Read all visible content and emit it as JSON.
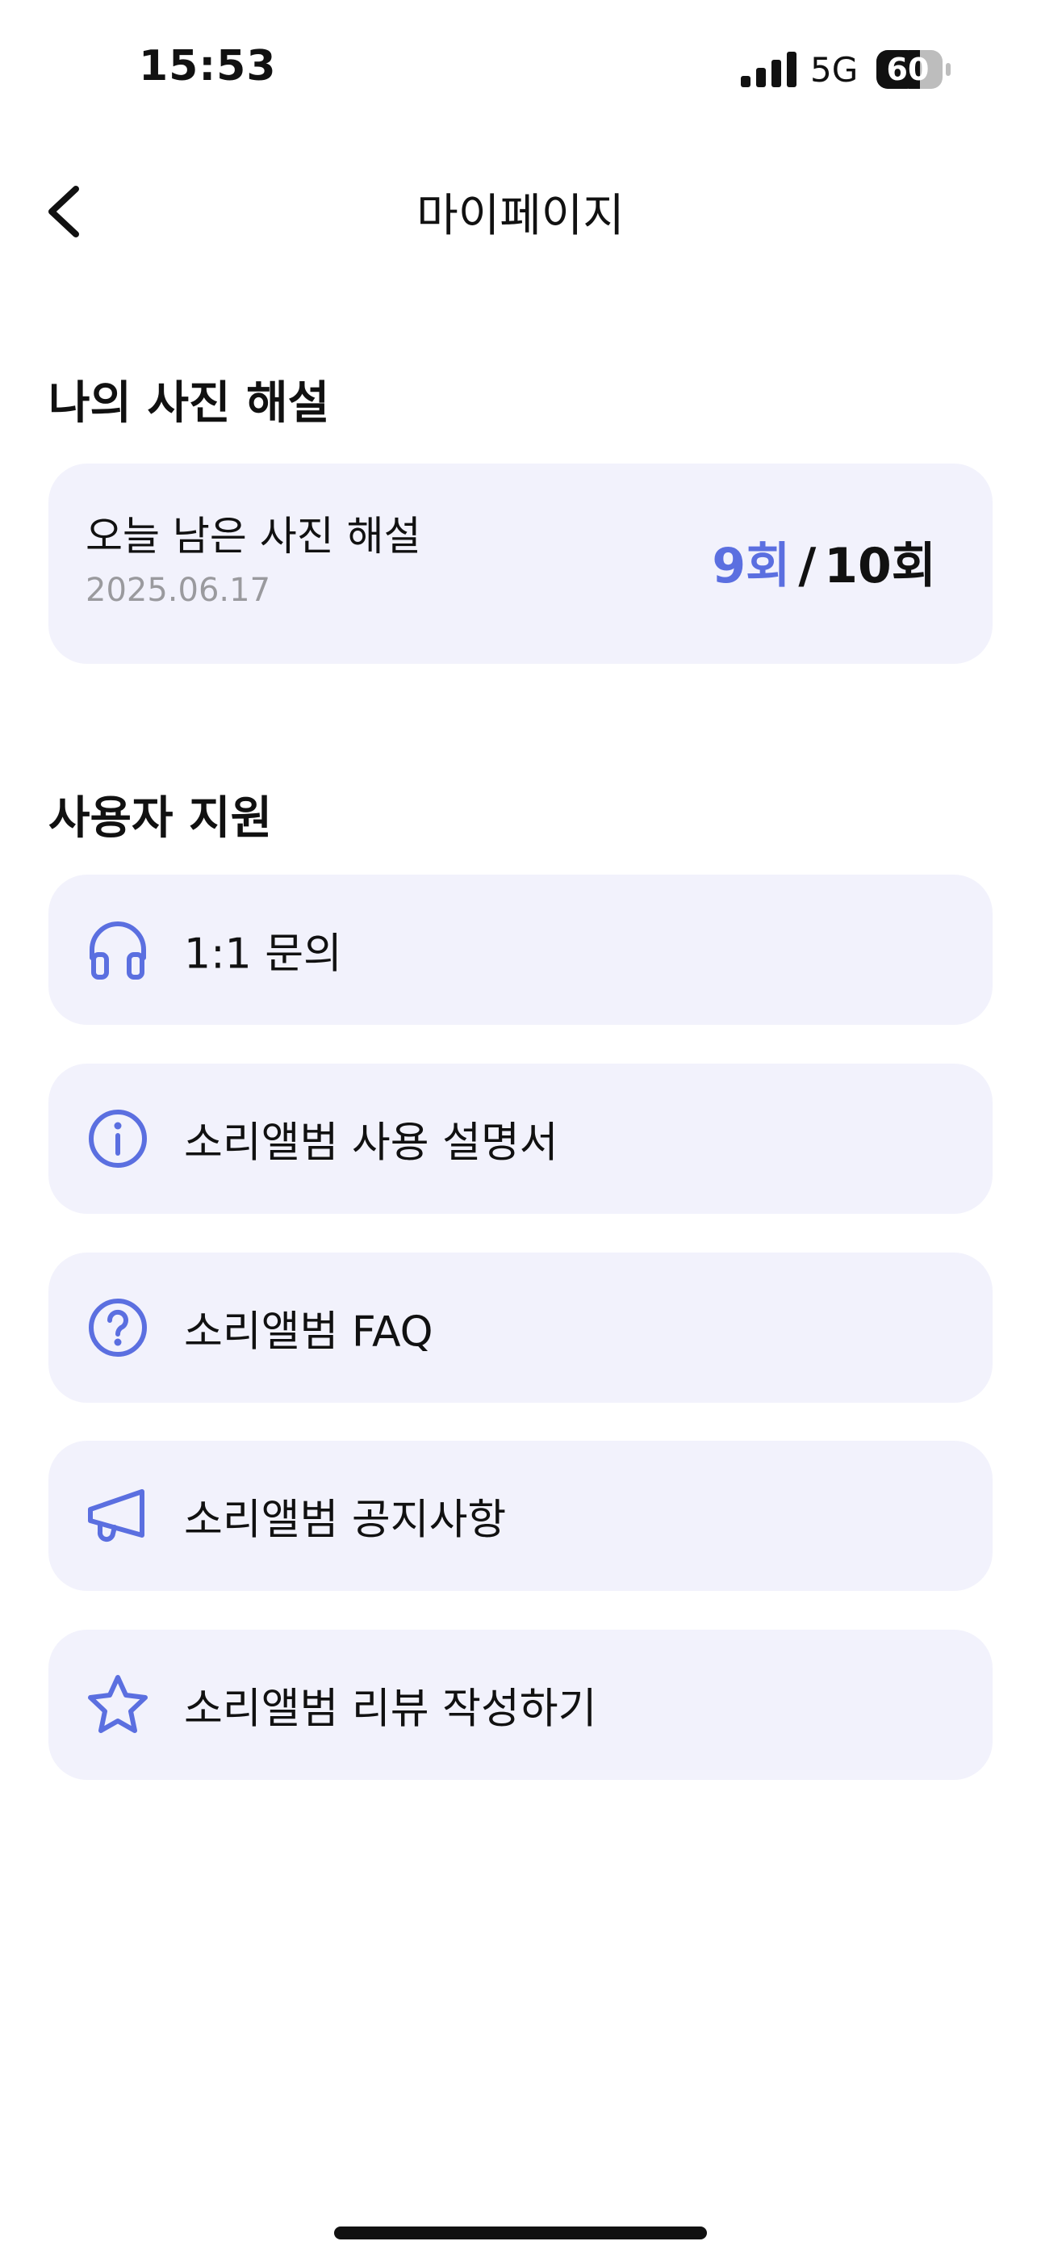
{
  "status_bar": {
    "time": "15:53",
    "network": "5G",
    "battery": "60"
  },
  "nav": {
    "back_icon": "chevron-left-icon",
    "title": "마이페이지"
  },
  "photo_section": {
    "title": "나의 사진 해설",
    "usage": {
      "label": "오늘 남은 사진 해설",
      "date": "2025.06.17",
      "used": "9회",
      "separator": "/",
      "total": "10회"
    }
  },
  "support_section": {
    "title": "사용자 지원",
    "items": [
      {
        "label": "1:1 문의",
        "icon": "headphones-icon"
      },
      {
        "label": "소리앨범 사용 설명서",
        "icon": "info-icon"
      },
      {
        "label": "소리앨범 FAQ",
        "icon": "question-icon"
      },
      {
        "label": "소리앨범 공지사항",
        "icon": "megaphone-icon"
      },
      {
        "label": "소리앨범 리뷰 작성하기",
        "icon": "star-icon"
      }
    ]
  },
  "colors": {
    "accent": "#5b6fe0",
    "card_background": "#f2f2fc",
    "text_primary": "#111111",
    "text_secondary": "#9a9a9e"
  }
}
